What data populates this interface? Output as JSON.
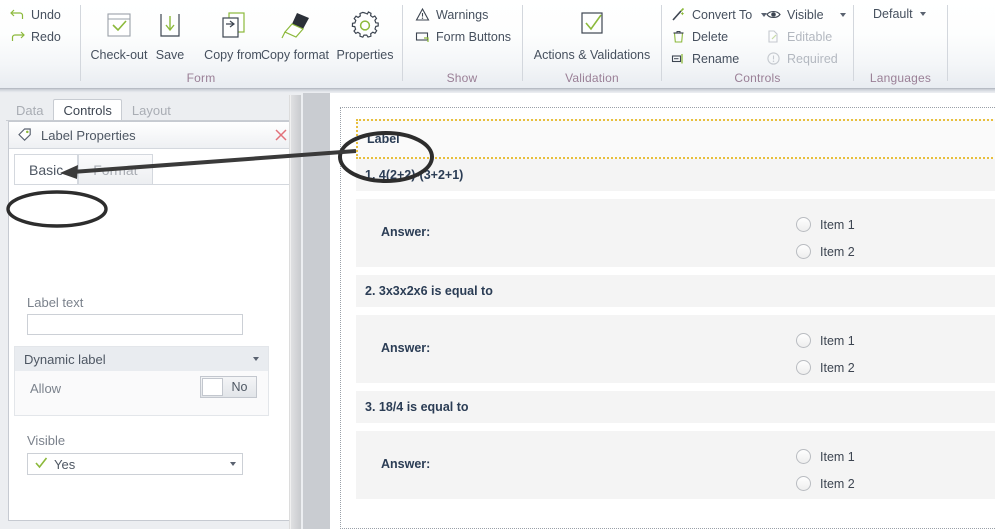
{
  "ribbon": {
    "groups": [
      {
        "title": "Form"
      },
      {
        "title": "Show"
      },
      {
        "title": "Validation"
      },
      {
        "title": "Controls"
      },
      {
        "title": "Languages"
      }
    ],
    "form_group": {
      "title": "Form",
      "undo_label": "Undo",
      "redo_label": "Redo",
      "buttons": [
        {
          "label": "Check-out",
          "icon": "checkout-icon"
        },
        {
          "label": "Save",
          "icon": "save-icon"
        },
        {
          "label": "Copy from",
          "icon": "copy-from-icon"
        },
        {
          "label": "Copy format",
          "icon": "copy-format-icon"
        },
        {
          "label": "Properties",
          "icon": "properties-gear-icon"
        }
      ]
    },
    "show_group": {
      "title": "Show",
      "warnings_label": "Warnings",
      "form_buttons_label": "Form Buttons"
    },
    "validation_group": {
      "title": "Validation",
      "actions_label": "Actions & Validations"
    },
    "controls_group": {
      "title": "Controls",
      "convert_to_label": "Convert To",
      "delete_label": "Delete",
      "rename_label": "Rename",
      "visible_label": "Visible",
      "editable_label": "Editable",
      "required_label": "Required"
    },
    "languages_group": {
      "title": "Languages",
      "default_label": "Default"
    }
  },
  "left_panel": {
    "tabs": [
      {
        "label": "Data",
        "active": false
      },
      {
        "label": "Controls",
        "active": true
      },
      {
        "label": "Layout",
        "active": false
      }
    ],
    "properties": {
      "title": "Label Properties",
      "icon": "tag-icon",
      "close_icon": "close-icon",
      "section_tabs": [
        {
          "label": "Basic",
          "active": true
        },
        {
          "label": "Format",
          "active": false
        }
      ],
      "label_text": {
        "label": "Label text",
        "value": "",
        "placeholder": ""
      },
      "dynamic_label": {
        "header": "Dynamic label",
        "allow_label": "Allow",
        "allow_value": "No"
      },
      "visible": {
        "label": "Visible",
        "value": "Yes"
      }
    }
  },
  "designer": {
    "selected_control": {
      "label": "Label",
      "selection_color": "#e8bf3c"
    },
    "questions": [
      {
        "text": "1. 4(2+2)-(3+2+1)",
        "answer_label": "Answer:",
        "options": [
          "Item 1",
          "Item 2"
        ]
      },
      {
        "text": "2. 3x3x2x6 is equal to",
        "answer_label": "Answer:",
        "options": [
          "Item 1",
          "Item 2"
        ]
      },
      {
        "text": "3. 18/4 is equal to",
        "answer_label": "Answer:",
        "options": [
          "Item 1",
          "Item 2"
        ]
      }
    ]
  },
  "colors": {
    "accent_green": "#8cb93b",
    "group_title": "#9a7f96",
    "selection": "#e8bf3c",
    "text": "#3d4551"
  }
}
